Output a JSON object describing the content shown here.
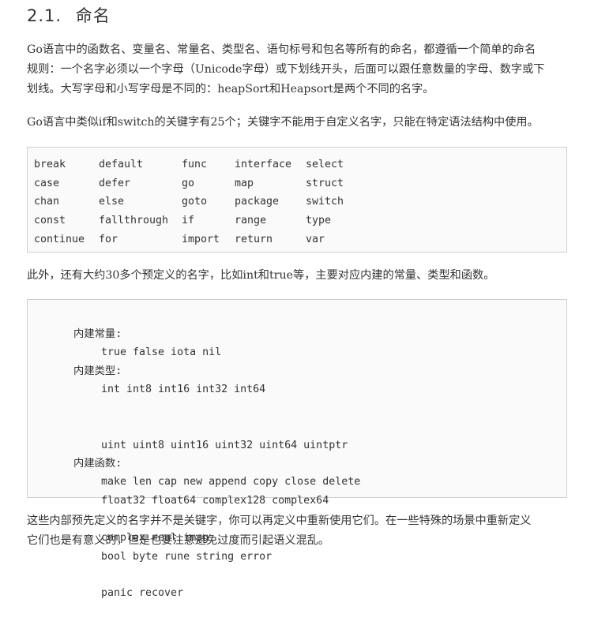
{
  "heading": {
    "number": "2.1.",
    "text": "命名"
  },
  "paragraphs": {
    "p1": [
      "Go语言中的函数名、变量名、常量名、类型名、语句标号和包名等所有的命名，都遵循一个简单的命名",
      "规则：一个名字必须以一个字母（Unicode字母）或下划线开头，后面可以跟任意数量的字母、数字或下",
      "划线。大写字母和小写字母是不同的：heapSort和Heapsort是两个不同的名字。"
    ],
    "p2": "Go语言中类似if和switch的关键字有25个；关键字不能用于自定义名字，只能在特定语法结构中使用。",
    "p3": "此外，还有大约30多个预定义的名字，比如int和true等，主要对应内建的常量、类型和函数。",
    "p4": [
      "这些内部预先定义的名字并不是关键字，你可以再定义中重新使用它们。在一些特殊的场景中重新定义",
      "它们也是有意义的，但是也要注意避免过度而引起语义混乱。"
    ]
  },
  "keywords": [
    [
      "break",
      "default",
      "func",
      "interface",
      "select"
    ],
    [
      "case",
      "defer",
      "go",
      "map",
      "struct"
    ],
    [
      "chan",
      "else",
      "goto",
      "package",
      "switch"
    ],
    [
      "const",
      "fallthrough",
      "if",
      "range",
      "type"
    ],
    [
      "continue",
      "for",
      "import",
      "return",
      "var"
    ]
  ],
  "predeclared": {
    "constants": {
      "label": "内建常量:",
      "lines": [
        "true false iota nil"
      ]
    },
    "types": {
      "label": "内建类型:",
      "lines": [
        "int int8 int16 int32 int64",
        "uint uint8 uint16 uint32 uint64 uintptr",
        "float32 float64 complex128 complex64",
        "bool byte rune string error"
      ]
    },
    "functions": {
      "label": "内建函数:",
      "lines": [
        "make len cap new append copy close delete",
        "complex real imag",
        "panic recover"
      ]
    }
  }
}
